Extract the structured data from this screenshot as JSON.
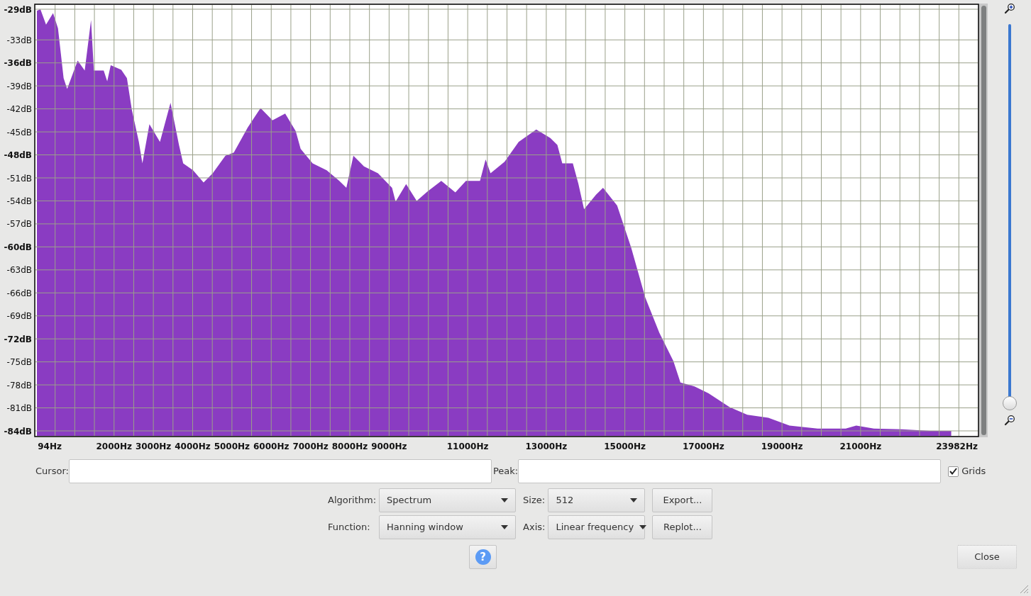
{
  "spectrum": {
    "chart_data": {
      "type": "area",
      "grid": true,
      "xlim": [
        0,
        23982
      ],
      "ylim": [
        -84,
        -29
      ],
      "x": [
        36,
        125,
        269,
        448,
        573,
        716,
        806,
        1074,
        1253,
        1414,
        1486,
        1736,
        1826,
        1915,
        2184,
        2327,
        2452,
        2631,
        2721,
        2900,
        3168,
        3437,
        3652,
        3759,
        4010,
        4278,
        4511,
        4833,
        5048,
        5406,
        5728,
        6032,
        6355,
        6623,
        6748,
        7053,
        7411,
        7733,
        7912,
        8091,
        8359,
        8717,
        9075,
        9165,
        9433,
        9702,
        9970,
        10328,
        10686,
        10955,
        11313,
        11456,
        11581,
        11939,
        12297,
        12745,
        13103,
        13282,
        13407,
        13676,
        13819,
        13962,
        14266,
        14445,
        14803,
        15161,
        15519,
        15877,
        16235,
        16414,
        16772,
        17130,
        17667,
        18115,
        18652,
        19189,
        19905,
        20621,
        20889,
        21337,
        22053,
        22769,
        23306
      ],
      "series": [
        {
          "color": "#8a3cc2",
          "values": [
            -29.2,
            -29,
            -31,
            -29.5,
            -31.5,
            -38,
            -39.4,
            -35.7,
            -37,
            -30.4,
            -37,
            -37,
            -38.4,
            -36.3,
            -36.9,
            -38,
            -42.1,
            -46.3,
            -49.1,
            -44,
            -46.3,
            -41.2,
            -46.7,
            -49.1,
            -50,
            -51.6,
            -50.4,
            -48.1,
            -47.7,
            -44.4,
            -41.9,
            -43.5,
            -42.6,
            -44.9,
            -47.2,
            -49.1,
            -50,
            -51.4,
            -52.3,
            -48.1,
            -49.5,
            -50.4,
            -52.3,
            -54.1,
            -51.8,
            -54,
            -52.8,
            -51.4,
            -52.9,
            -51.4,
            -51.4,
            -48.6,
            -50.4,
            -48.9,
            -46.3,
            -44.7,
            -45.8,
            -46.7,
            -49.1,
            -49.1,
            -51.8,
            -55.1,
            -53.2,
            -52.3,
            -54.6,
            -60.1,
            -66.6,
            -71.2,
            -74.9,
            -77.7,
            -78.2,
            -79.1,
            -80.9,
            -81.9,
            -82.3,
            -83.3,
            -83.7,
            -83.7,
            -83.3,
            -83.7,
            -83.8,
            -84,
            -84
          ]
        }
      ],
      "yticks": [
        {
          "value": -29,
          "label": "-29dB"
        },
        {
          "value": -33,
          "label": "-33dB"
        },
        {
          "value": -36,
          "label": "-36dB"
        },
        {
          "value": -39,
          "label": "-39dB"
        },
        {
          "value": -42,
          "label": "-42dB"
        },
        {
          "value": -45,
          "label": "-45dB"
        },
        {
          "value": -48,
          "label": "-48dB"
        },
        {
          "value": -51,
          "label": "-51dB"
        },
        {
          "value": -54,
          "label": "-54dB"
        },
        {
          "value": -57,
          "label": "-57dB"
        },
        {
          "value": -60,
          "label": "-60dB"
        },
        {
          "value": -63,
          "label": "-63dB"
        },
        {
          "value": -66,
          "label": "-66dB"
        },
        {
          "value": -69,
          "label": "-69dB"
        },
        {
          "value": -72,
          "label": "-72dB"
        },
        {
          "value": -75,
          "label": "-75dB"
        },
        {
          "value": -78,
          "label": "-78dB"
        },
        {
          "value": -81,
          "label": "-81dB"
        },
        {
          "value": -84,
          "label": "-84dB"
        }
      ],
      "xticks": [
        {
          "value": 94,
          "label": "94Hz"
        },
        {
          "value": 2000,
          "label": "2000Hz"
        },
        {
          "value": 3000,
          "label": "3000Hz"
        },
        {
          "value": 4000,
          "label": "4000Hz"
        },
        {
          "value": 5000,
          "label": "5000Hz"
        },
        {
          "value": 6000,
          "label": "6000Hz"
        },
        {
          "value": 7000,
          "label": "7000Hz"
        },
        {
          "value": 8000,
          "label": "8000Hz"
        },
        {
          "value": 9000,
          "label": "9000Hz"
        },
        {
          "value": 11000,
          "label": "11000Hz"
        },
        {
          "value": 13000,
          "label": "13000Hz"
        },
        {
          "value": 15000,
          "label": "15000Hz"
        },
        {
          "value": 17000,
          "label": "17000Hz"
        },
        {
          "value": 19000,
          "label": "19000Hz"
        },
        {
          "value": 21000,
          "label": "21000Hz"
        },
        {
          "value": 23982,
          "label": "23982Hz"
        }
      ]
    }
  },
  "zoom_slider": {
    "level": 0
  },
  "cursor": {
    "label": "Cursor:"
  },
  "peak": {
    "label": "Peak:"
  },
  "grids": {
    "label": "Grids",
    "checked": true
  },
  "algorithm": {
    "label": "Algorithm:",
    "value": "Spectrum"
  },
  "size": {
    "label": "Size:",
    "value": "512"
  },
  "function": {
    "label": "Function:",
    "value": "Hanning window"
  },
  "axis": {
    "label": "Axis:",
    "value": "Linear frequency"
  },
  "export_button": {
    "label": "Export..."
  },
  "replot_button": {
    "label": "Replot..."
  },
  "help_button": {
    "label": "?"
  },
  "close_button": {
    "label": "Close"
  }
}
